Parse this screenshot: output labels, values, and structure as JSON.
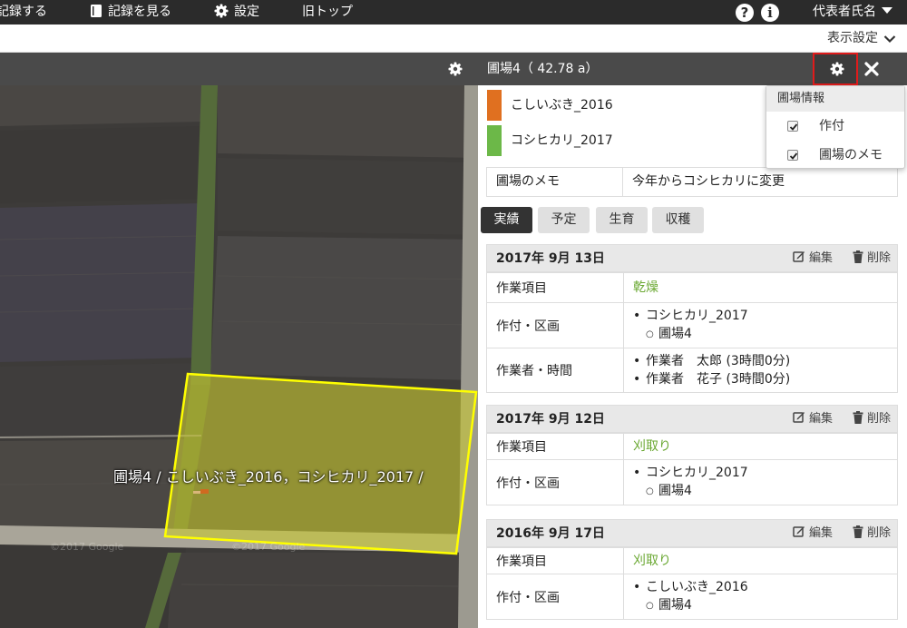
{
  "nav": {
    "record": "記録する",
    "view_records": "記録を見る",
    "settings": "設定",
    "old_top": "旧トップ",
    "help_glyph": "?",
    "info_glyph": "i",
    "user_name": "代表者氏名"
  },
  "subbar": {
    "display_settings": "表示設定"
  },
  "header": {
    "field_title": "圃場4（ 42.78 a）"
  },
  "map": {
    "label": "圃場4 / こしいぶき_2016，コシヒカリ_2017 /",
    "watermark": "©2017 Google"
  },
  "crops": [
    {
      "name": "こしいぶき_2016",
      "color": "#e07020"
    },
    {
      "name": "コシヒカリ_2017",
      "color": "#6cb848"
    }
  ],
  "memo": {
    "label": "圃場のメモ",
    "value": "今年からコシヒカリに変更"
  },
  "tabs": [
    {
      "label": "実績",
      "active": true
    },
    {
      "label": "予定",
      "active": false
    },
    {
      "label": "生育",
      "active": false
    },
    {
      "label": "収穫",
      "active": false
    }
  ],
  "actions": {
    "edit": "編集",
    "delete": "削除"
  },
  "labels": {
    "work_item": "作業項目",
    "crop_section": "作付・区画",
    "worker_time": "作業者・時間"
  },
  "records": [
    {
      "date": "2017年 9月 13日",
      "work_item": "乾燥",
      "crop": "コシヒカリ_2017",
      "section": "圃場4",
      "workers": [
        "作業者　太郎 (3時間0分)",
        "作業者　花子 (3時間0分)"
      ]
    },
    {
      "date": "2017年 9月 12日",
      "work_item": "刈取り",
      "crop": "コシヒカリ_2017",
      "section": "圃場4"
    },
    {
      "date": "2016年 9月 17日",
      "work_item": "刈取り",
      "crop": "こしいぶき_2016",
      "section": "圃場4"
    }
  ],
  "dropdown": {
    "header": "圃場情報",
    "items": [
      {
        "label": "作付",
        "checked": true
      },
      {
        "label": "圃場のメモ",
        "checked": true
      }
    ]
  },
  "colors": {
    "highlight": "#e01b1b",
    "accent_green": "#6aa832",
    "field_overlay": "#c8c832",
    "field_border": "#ffff00"
  }
}
